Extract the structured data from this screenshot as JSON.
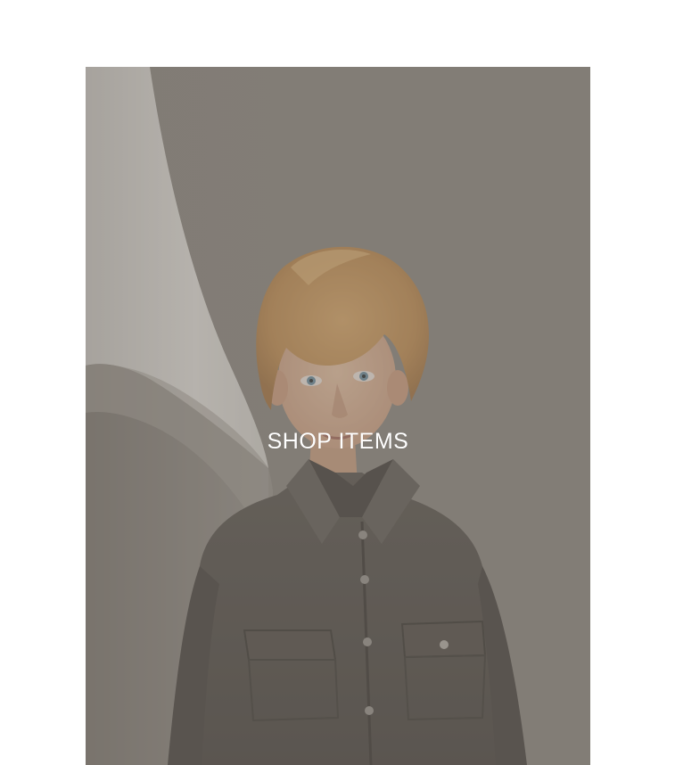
{
  "promo": {
    "cta_label": "SHOP ITEMS",
    "image_subject": "boy-in-dark-shirt-photo"
  },
  "colors": {
    "page_background": "#ffffff",
    "backdrop": "#8a857e",
    "overlay": "#6e6862",
    "cta_text": "#ffffff"
  }
}
